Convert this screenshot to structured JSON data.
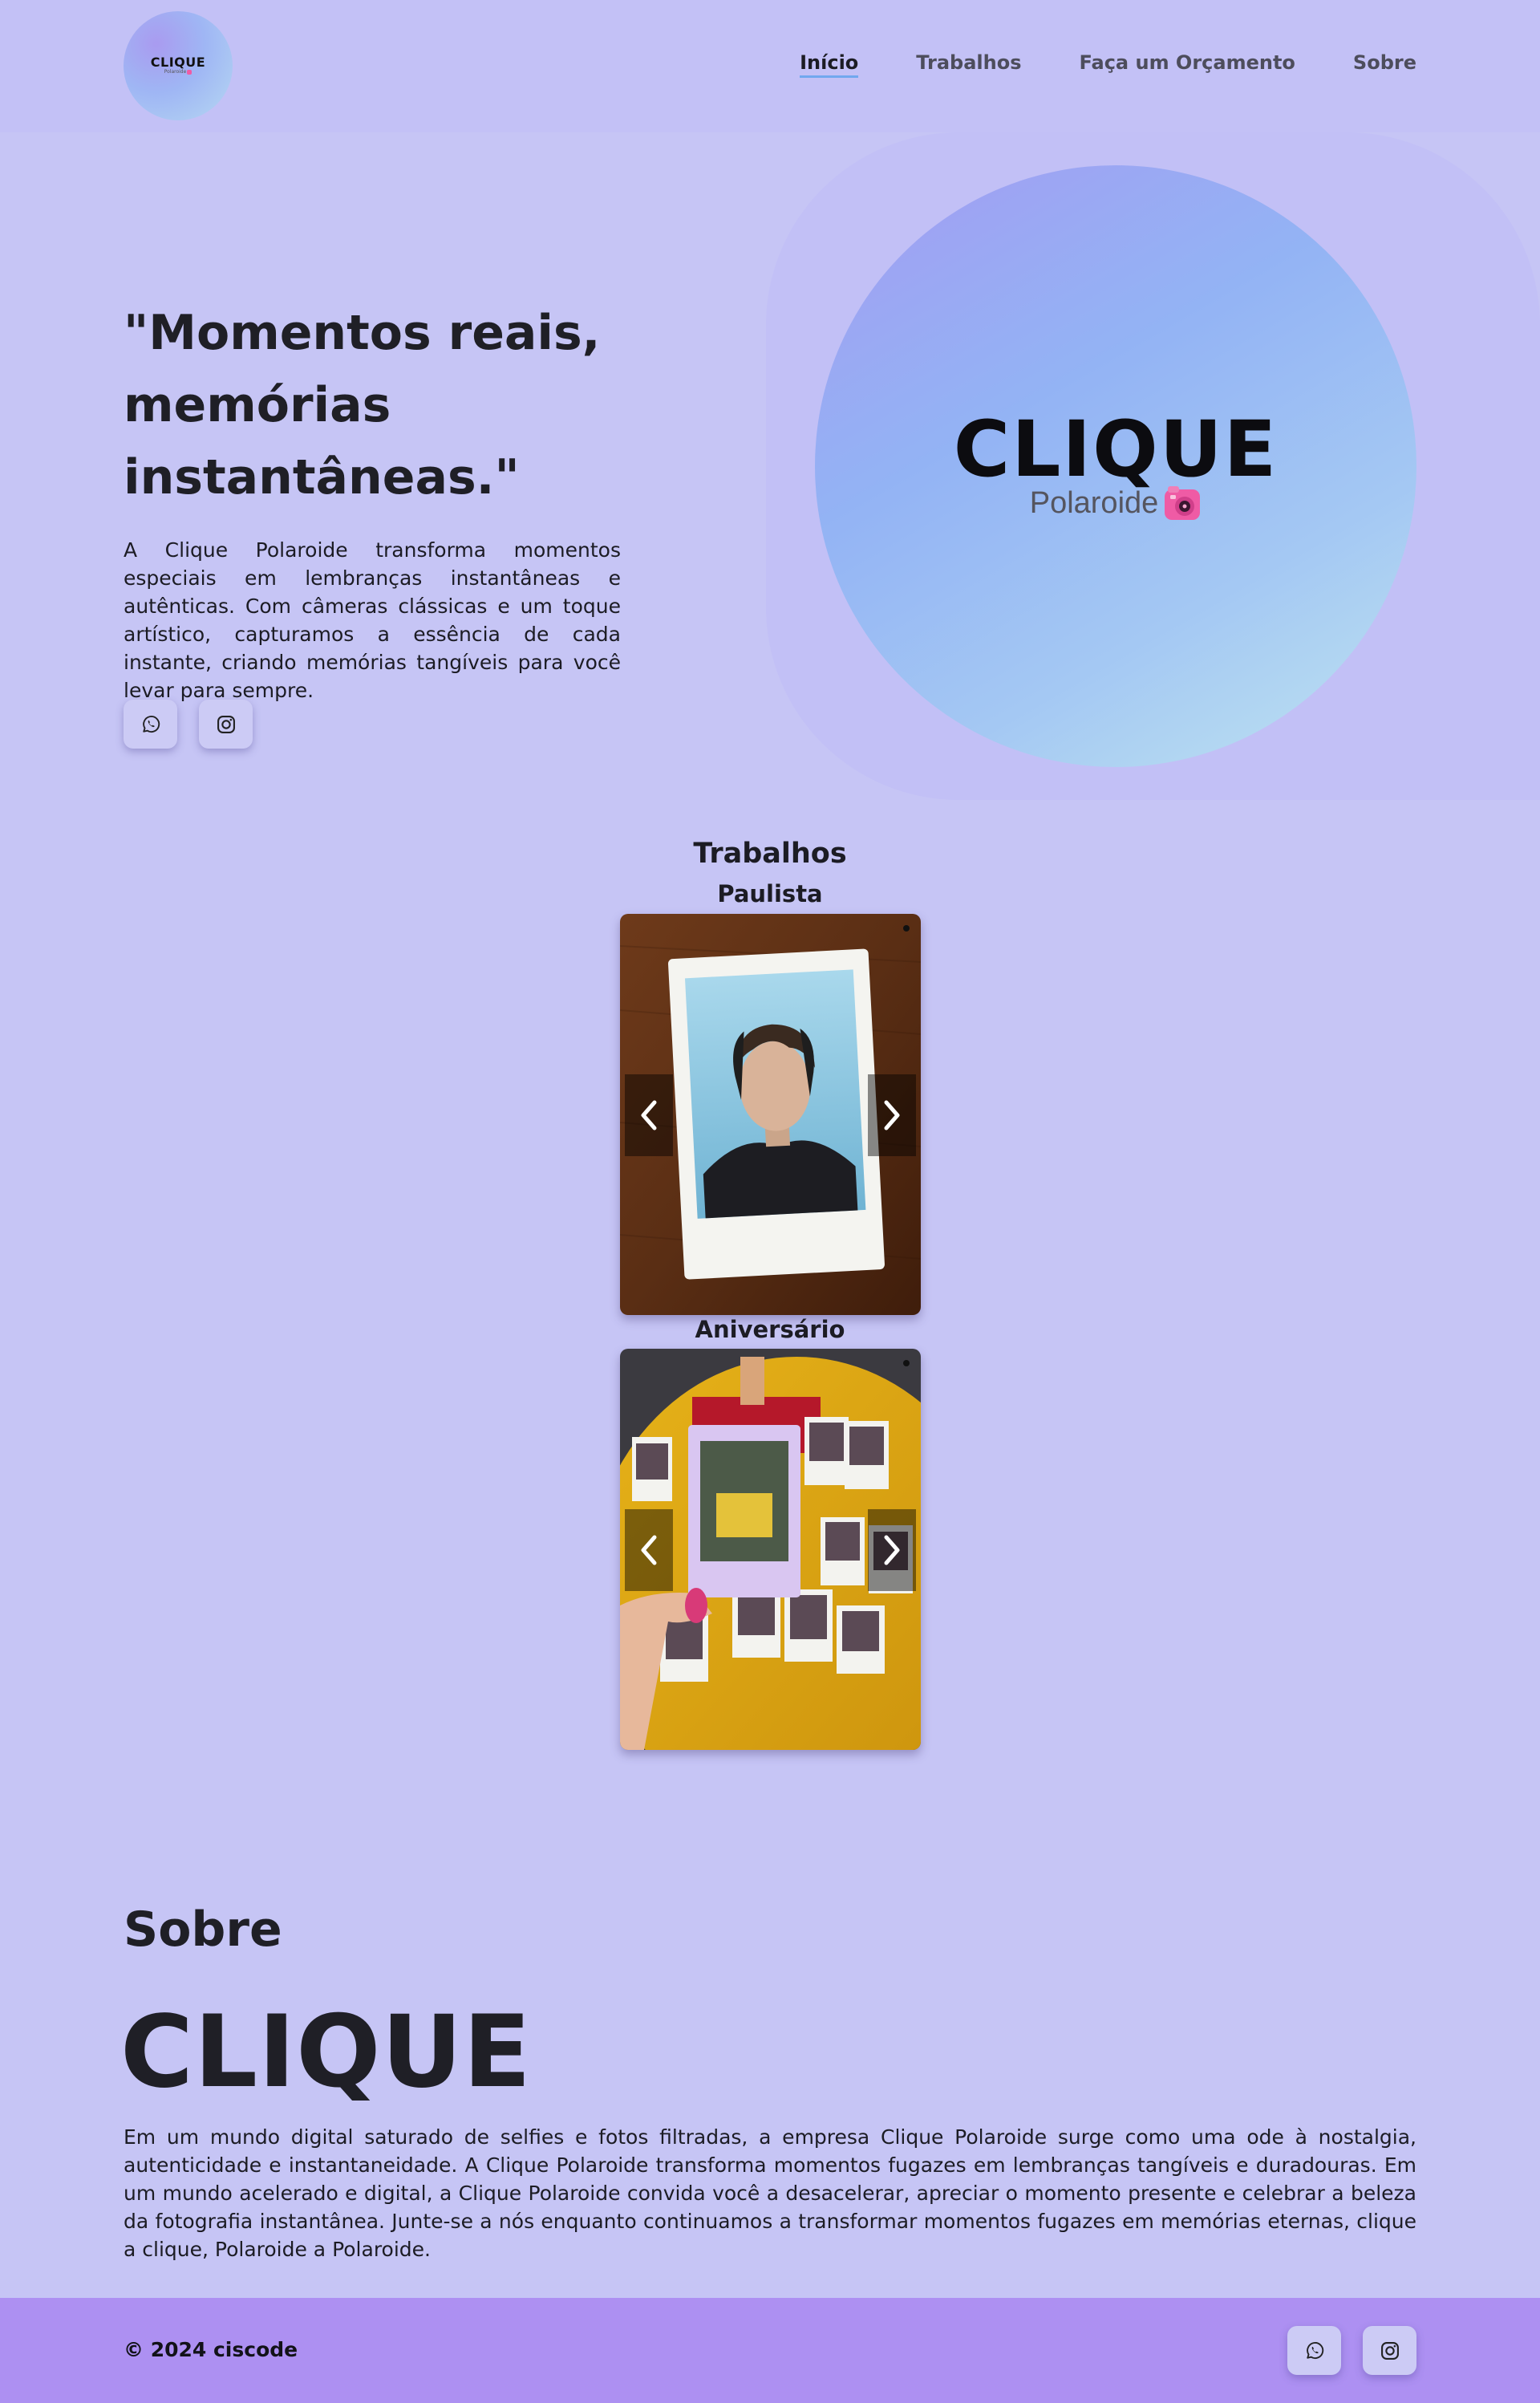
{
  "nav": {
    "logo": {
      "word": "CLIQUE",
      "sub": "Polaroide"
    },
    "links": [
      {
        "label": "Início",
        "active": true
      },
      {
        "label": "Trabalhos",
        "active": false
      },
      {
        "label": "Faça um Orçamento",
        "active": false
      },
      {
        "label": "Sobre",
        "active": false
      }
    ]
  },
  "hero": {
    "title_lines": [
      "\"Momentos reais,",
      "memórias",
      "instantâneas.\""
    ],
    "description": "A Clique Polaroide transforma momentos especiais em lembranças instantâneas e autênticas. Com câmeras clássicas e um toque artístico, capturamos a essência de cada instante, criando memórias tangíveis para você levar para sempre.",
    "brand_word": "CLIQUE",
    "brand_sub": "Polaroide",
    "social": [
      {
        "icon": "whatsapp-icon"
      },
      {
        "icon": "instagram-icon"
      }
    ]
  },
  "works": {
    "title": "Trabalhos",
    "albums": [
      {
        "title": "Paulista"
      },
      {
        "title": "Aniversário"
      }
    ]
  },
  "about": {
    "heading": "Sobre",
    "brand": "CLIQUE",
    "text": "Em um mundo digital saturado de selfies e fotos filtradas, a empresa Clique Polaroide surge como uma ode à nostalgia, autenticidade e instantaneidade. A Clique Polaroide transforma momentos fugazes em lembranças tangíveis e duradouras. Em um mundo acelerado e digital, a Clique Polaroide convida você a desacelerar, apreciar o momento presente e celebrar a beleza da fotografia instantânea. Junte-se a nós enquanto continuamos a transformar momentos fugazes em memórias eternas, clique a clique, Polaroide a Polaroide."
  },
  "footer": {
    "copyright": "© 2024 ciscode"
  },
  "colors": {
    "background": "#c6c5f5",
    "footer": "#ad90f2",
    "accent_underline": "#71a8ef",
    "camera_pink": "#ef5ba5"
  }
}
